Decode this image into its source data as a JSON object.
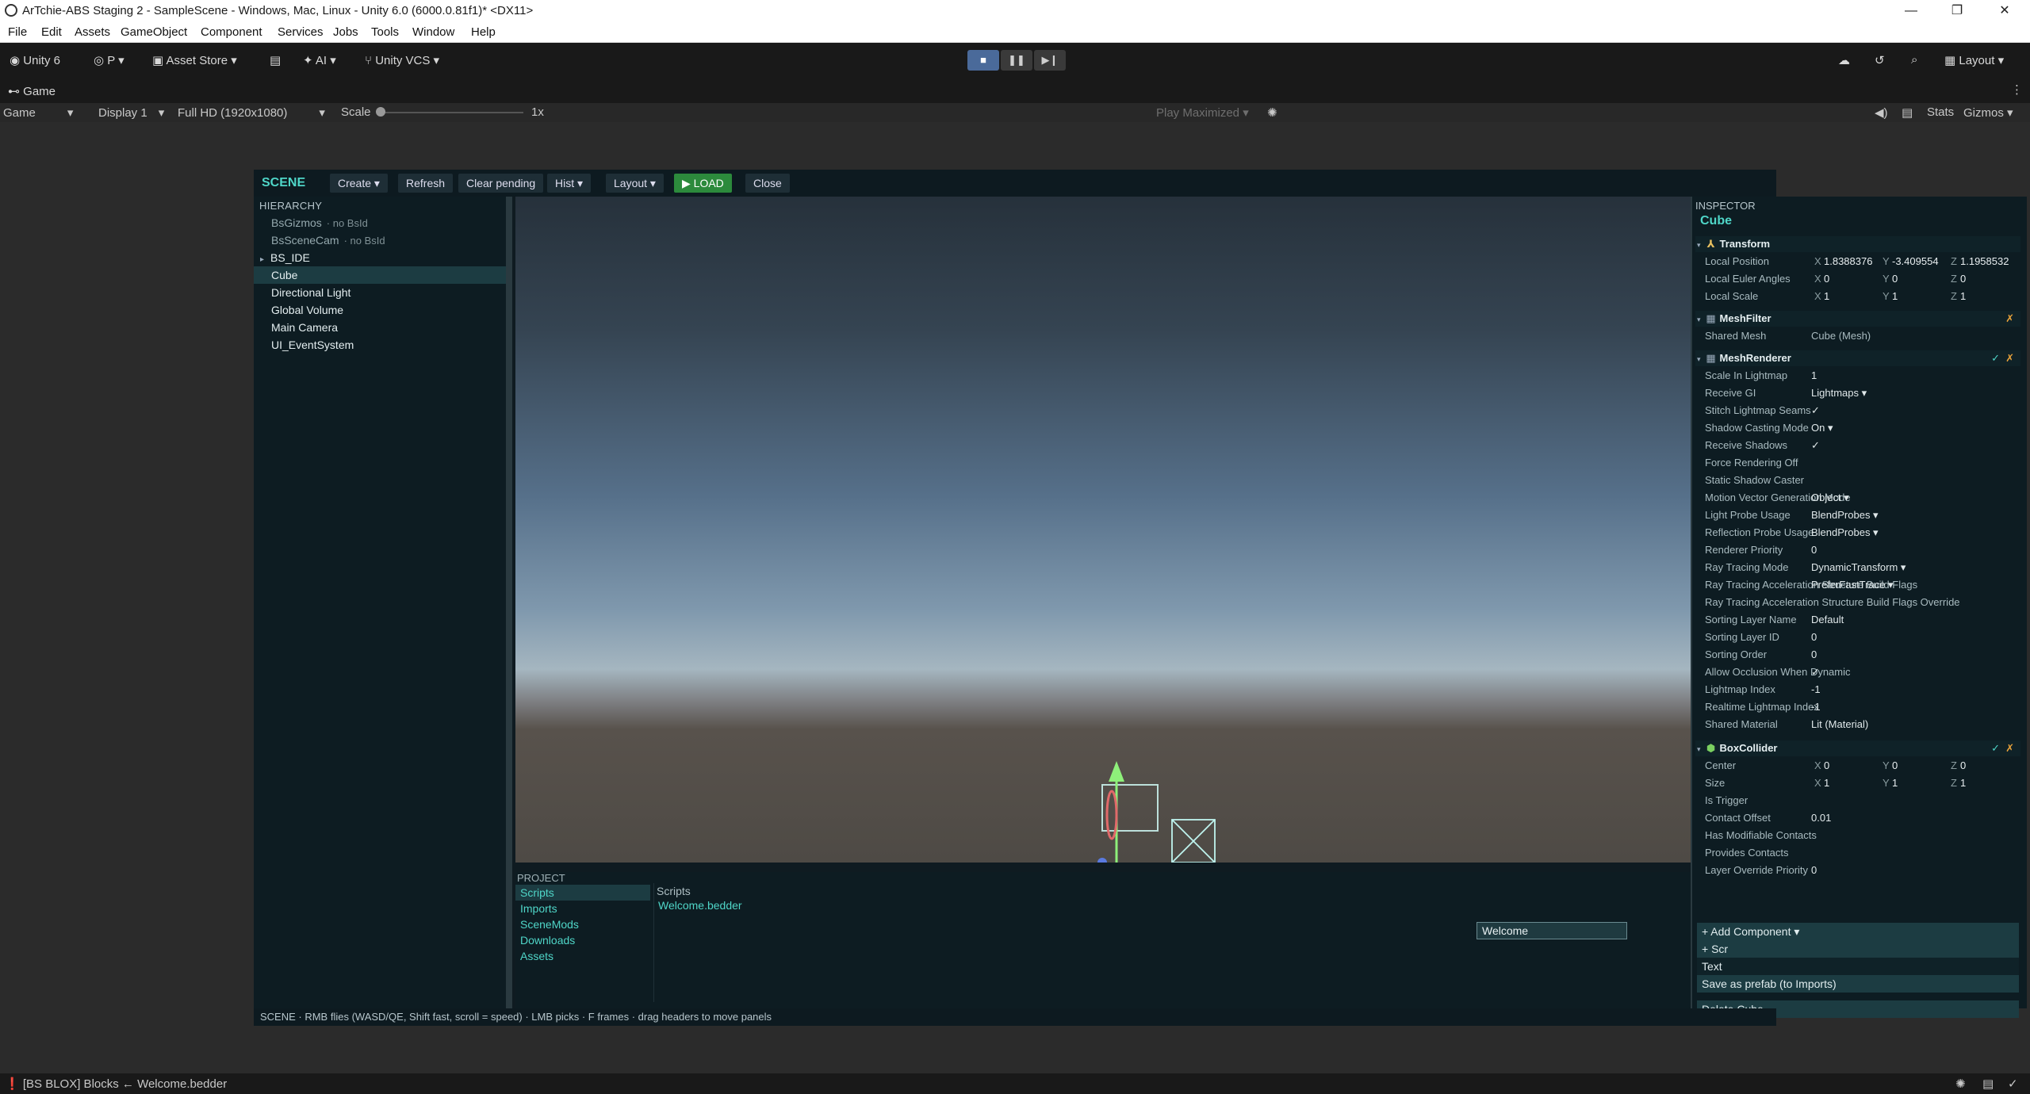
{
  "window": {
    "title": "ArTchie-ABS Staging 2 - SampleScene - Windows, Mac, Linux - Unity 6.0 (6000.0.81f1)* <DX11>",
    "controls": [
      "—",
      "❐",
      "✕"
    ]
  },
  "menu": [
    "File",
    "Edit",
    "Assets",
    "GameObject",
    "Component",
    "Services",
    "Jobs",
    "Tools",
    "Window",
    "Help"
  ],
  "toolbar": {
    "unity_label": "Unity 6",
    "account": "P",
    "asset_store": "Asset Store",
    "ai": "AI",
    "vcs": "Unity VCS",
    "layout": "Layout"
  },
  "game": {
    "tab": "Game",
    "mode": "Game",
    "display": "Display 1",
    "resolution": "Full HD (1920x1080)",
    "scale_label": "Scale",
    "scale_value": "1x",
    "play_mode": "Play Maximized",
    "stats": "Stats",
    "gizmos": "Gizmos"
  },
  "ide": {
    "scene_label": "SCENE",
    "buttons": {
      "create": "Create ▾",
      "refresh": "Refresh",
      "clear_pending": "Clear pending",
      "hist": "Hist ▾",
      "layout": "Layout ▾",
      "load": "▶ LOAD",
      "close": "Close"
    },
    "hierarchy": {
      "header": "HIERARCHY",
      "items": [
        {
          "name": "BsGizmos",
          "note": "· no BsId"
        },
        {
          "name": "BsSceneCam",
          "note": "· no BsId"
        },
        {
          "name": "BS_IDE",
          "note": ""
        },
        {
          "name": "Cube",
          "note": ""
        },
        {
          "name": "Directional Light",
          "note": ""
        },
        {
          "name": "Global Volume",
          "note": ""
        },
        {
          "name": "Main Camera",
          "note": ""
        },
        {
          "name": "UI_EventSystem",
          "note": ""
        }
      ]
    },
    "project": {
      "header": "PROJECT",
      "folders": [
        "Scripts",
        "Imports",
        "SceneMods",
        "Downloads",
        "Assets"
      ],
      "current_folder": "Scripts",
      "files": [
        "Welcome.bedder"
      ]
    },
    "inspector": {
      "header": "INSPECTOR",
      "object": "Cube",
      "transform": {
        "title": "Transform",
        "position_label": "Local Position",
        "position": {
          "x": "1.8388376",
          "y": "-3.409554",
          "z": "1.1958532"
        },
        "rotation_label": "Local Euler Angles",
        "rotation": {
          "x": "0",
          "y": "0",
          "z": "0"
        },
        "scale_label": "Local Scale",
        "scale": {
          "x": "1",
          "y": "1",
          "z": "1"
        }
      },
      "meshfilter": {
        "title": "MeshFilter",
        "shared_mesh_label": "Shared Mesh",
        "shared_mesh": "Cube (Mesh)"
      },
      "meshrenderer": {
        "title": "MeshRenderer",
        "rows": [
          {
            "label": "Scale In Lightmap",
            "value": "1"
          },
          {
            "label": "Receive GI",
            "value": "Lightmaps ▾"
          },
          {
            "label": "Stitch Lightmap Seams",
            "value": "✓"
          },
          {
            "label": "Shadow Casting Mode",
            "value": "On ▾"
          },
          {
            "label": "Receive Shadows",
            "value": "✓"
          },
          {
            "label": "Force Rendering Off",
            "value": ""
          },
          {
            "label": "Static Shadow Caster",
            "value": ""
          },
          {
            "label": "Motion Vector Generation Mode",
            "value": "Object ▾"
          },
          {
            "label": "Light Probe Usage",
            "value": "BlendProbes ▾"
          },
          {
            "label": "Reflection Probe Usage",
            "value": "BlendProbes ▾"
          },
          {
            "label": "Renderer Priority",
            "value": "0"
          },
          {
            "label": "Ray Tracing Mode",
            "value": "DynamicTransform ▾"
          },
          {
            "label": "Ray Tracing Acceleration Structure Build Flags",
            "value": "PreferFastTrace ▾"
          },
          {
            "label": "Ray Tracing Acceleration Structure Build Flags Override",
            "value": ""
          },
          {
            "label": "Sorting Layer Name",
            "value": "Default"
          },
          {
            "label": "Sorting Layer ID",
            "value": "0"
          },
          {
            "label": "Sorting Order",
            "value": "0"
          },
          {
            "label": "Allow Occlusion When Dynamic",
            "value": "✓"
          },
          {
            "label": "Lightmap Index",
            "value": "-1"
          },
          {
            "label": "Realtime Lightmap Index",
            "value": "-1"
          },
          {
            "label": "Shared Material",
            "value": "Lit (Material)"
          }
        ]
      },
      "boxcollider": {
        "title": "BoxCollider",
        "center_label": "Center",
        "center": {
          "x": "0",
          "y": "0",
          "z": "0"
        },
        "size_label": "Size",
        "size": {
          "x": "1",
          "y": "1",
          "z": "1"
        },
        "rows": [
          {
            "label": "Is Trigger",
            "value": ""
          },
          {
            "label": "Contact Offset",
            "value": "0.01"
          },
          {
            "label": "Has Modifiable Contacts",
            "value": ""
          },
          {
            "label": "Provides Contacts",
            "value": ""
          },
          {
            "label": "Layer Override Priority",
            "value": "0"
          }
        ]
      },
      "add_component": "+ Add Component ▾",
      "add_script": "+ Scr",
      "text_row": "Text",
      "save_prefab": "Save as prefab (to Imports)",
      "delete": "Delete Cube",
      "popup_item": "Welcome"
    },
    "status": "SCENE · RMB flies (WASD/QE, Shift fast, scroll = speed) · LMB picks · F frames · drag headers to move panels"
  },
  "statusbar": {
    "message": "[BS BLOX] Blocks ← Welcome.bedder"
  },
  "colors": {
    "accent": "#4fd6c8",
    "load_green": "#2c8a3c",
    "remove_orange": "#e8a23a"
  }
}
